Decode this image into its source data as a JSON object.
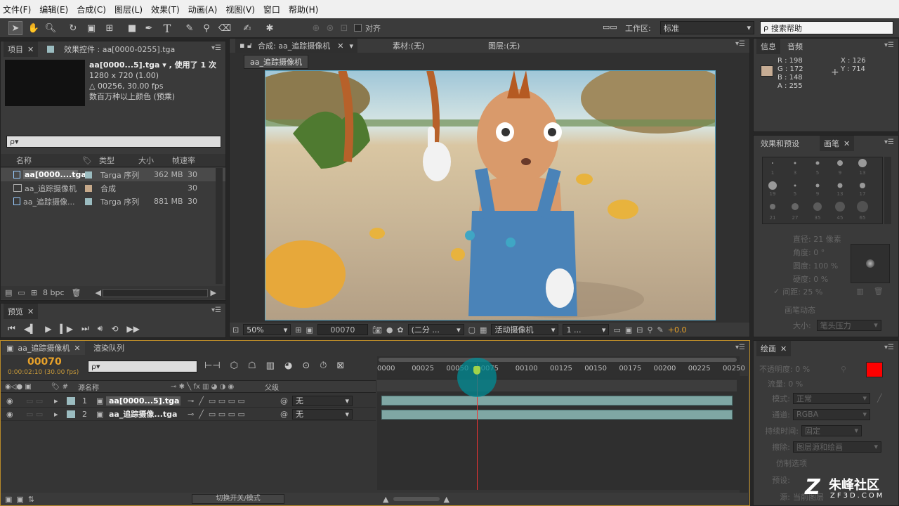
{
  "menu": [
    "文件(F)",
    "编辑(E)",
    "合成(C)",
    "图层(L)",
    "效果(T)",
    "动画(A)",
    "视图(V)",
    "窗口",
    "帮助(H)"
  ],
  "toolbar": {
    "snap_label": "对齐",
    "workspace_label": "工作区:",
    "workspace_value": "标准",
    "search_placeholder": "搜索帮助"
  },
  "project": {
    "tab_project": "项目",
    "tab_effects": "效果控件 : aa[0000-0255].tga",
    "info_name": "aa[0000...5].tga ▾ , 使用了 1 次",
    "info_res": "1280 x 720 (1.00)",
    "info_dur": "△ 00256, 30.00 fps",
    "info_color": "数百万种以上颜色 (预乘)",
    "search_glyph": "ρ▾",
    "columns": [
      "名称",
      "类型",
      "大小",
      "帧速率"
    ],
    "items": [
      {
        "name": "aa[0000....tga",
        "type": "Targa 序列",
        "size": "362 MB",
        "fps": "30",
        "color": "#9bbcc0"
      },
      {
        "name": "aa_追踪摄像机",
        "type": "合成",
        "size": "",
        "fps": "30",
        "color": "#c6a98a"
      },
      {
        "name": "aa_追踪摄像...",
        "type": "Targa 序列",
        "size": "881 MB",
        "fps": "30",
        "color": "#9bbcc0"
      }
    ],
    "bpc": "8 bpc"
  },
  "preview": {
    "tab": "预览"
  },
  "comp": {
    "tab_comp": "合成: aa_追踪摄像机",
    "tab_footage": "素材:(无)",
    "tab_layer": "图层:(无)",
    "sub_tab": "aa_追踪摄像机",
    "zoom": "50%",
    "timecode": "00070",
    "resolution": "(二分 ...",
    "camera": "活动摄像机",
    "views": "1 ...",
    "exposure": "+0.0"
  },
  "info": {
    "tab_info": "信息",
    "tab_audio": "音频",
    "r": "R : 198",
    "g": "G : 172",
    "b": "B : 148",
    "a": "A : 255",
    "x": "X : 126",
    "y": "Y : 714",
    "swatch": "#c6ac94"
  },
  "brushes": {
    "tab_effects": "效果和预设",
    "tab_brush": "画笔",
    "sizes": [
      "1",
      "3",
      "5",
      "9",
      "13",
      "19",
      "5",
      "9",
      "13",
      "17",
      "21",
      "27",
      "35",
      "45",
      "65"
    ],
    "diameter": "直径: 21 像素",
    "angle": "角度: 0 °",
    "roundness": "圆度: 100 %",
    "hardness": "硬度: 0 %",
    "spacing": "间距: 25 %",
    "dynamics": "画笔动态",
    "size_label": "大小:",
    "size_value": "笔头压力"
  },
  "paint": {
    "tab": "绘画",
    "opacity": "不透明度: 0 %",
    "flow": "流量: 0 %",
    "mode_label": "模式:",
    "mode_value": "正常",
    "channel_label": "通道:",
    "channel_value": "RGBA",
    "duration_label": "持续时间:",
    "duration_value": "固定",
    "erase_label": "擦除:",
    "erase_value": "图层源和绘画",
    "clone": "仿制选项",
    "preset_label": "预设:",
    "source_label": "源:",
    "source_value": "当前图层",
    "fg_color": "#ff0000",
    "bg_color": "#ffffff"
  },
  "timeline": {
    "tab_comp": "aa_追踪摄像机",
    "tab_render": "渲染队列",
    "timecode": "00070",
    "timecode_sub": "0:00:02:10 (30.00 fps)",
    "search_glyph": "ρ▾",
    "col_source": "源名称",
    "col_parent": "父级",
    "col_switches": "fx",
    "ruler": [
      "0000",
      "00025",
      "00050",
      "0075",
      "00100",
      "00125",
      "00150",
      "00175",
      "00200",
      "00225",
      "00250"
    ],
    "layers": [
      {
        "num": "1",
        "name": "aa[0000...5].tga",
        "parent": "无"
      },
      {
        "num": "2",
        "name": "aa_追踪摄像...tga",
        "parent": "无"
      }
    ],
    "toggle_label": "切换开关/模式",
    "playhead_frame": 70,
    "total_frames": 256
  },
  "watermark": {
    "line1": "朱峰社区",
    "line2": "ZF3D.COM"
  }
}
